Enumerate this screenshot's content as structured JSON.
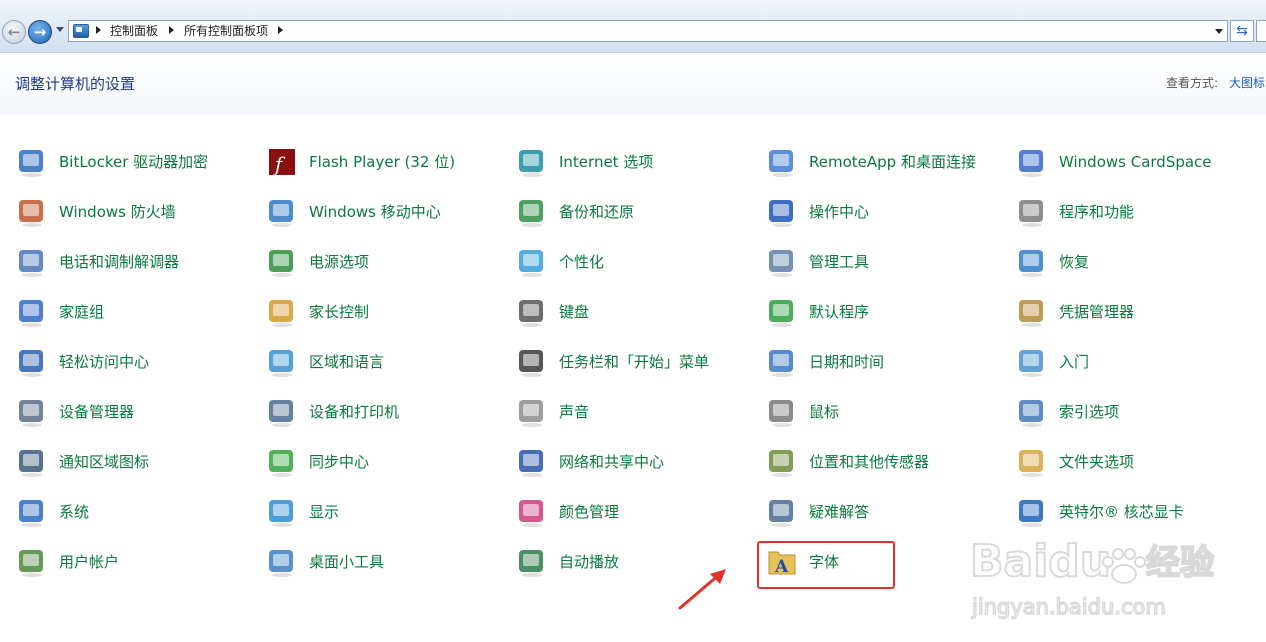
{
  "addressBar": {
    "crumbs": [
      "控制面板",
      "所有控制面板项"
    ]
  },
  "header": {
    "title": "调整计算机的设置",
    "viewLabel": "查看方式:",
    "viewValue": "大图标"
  },
  "items": [
    {
      "label": "BitLocker 驱动器加密",
      "icon": "bitlocker-icon"
    },
    {
      "label": "Flash Player (32 位)",
      "icon": "flash-player-icon"
    },
    {
      "label": "Internet 选项",
      "icon": "internet-options-icon"
    },
    {
      "label": "RemoteApp 和桌面连接",
      "icon": "remoteapp-icon"
    },
    {
      "label": "Windows CardSpace",
      "icon": "cardspace-icon"
    },
    {
      "label": "Windows 防火墙",
      "icon": "firewall-icon"
    },
    {
      "label": "Windows 移动中心",
      "icon": "mobility-center-icon"
    },
    {
      "label": "备份和还原",
      "icon": "backup-restore-icon"
    },
    {
      "label": "操作中心",
      "icon": "action-center-flag-icon"
    },
    {
      "label": "程序和功能",
      "icon": "programs-features-icon"
    },
    {
      "label": "电话和调制解调器",
      "icon": "phone-modem-icon"
    },
    {
      "label": "电源选项",
      "icon": "power-options-icon"
    },
    {
      "label": "个性化",
      "icon": "personalization-icon"
    },
    {
      "label": "管理工具",
      "icon": "admin-tools-icon"
    },
    {
      "label": "恢复",
      "icon": "recovery-icon"
    },
    {
      "label": "家庭组",
      "icon": "homegroup-icon"
    },
    {
      "label": "家长控制",
      "icon": "parental-controls-icon"
    },
    {
      "label": "键盘",
      "icon": "keyboard-icon"
    },
    {
      "label": "默认程序",
      "icon": "default-programs-icon"
    },
    {
      "label": "凭据管理器",
      "icon": "credential-manager-icon"
    },
    {
      "label": "轻松访问中心",
      "icon": "ease-of-access-icon"
    },
    {
      "label": "区域和语言",
      "icon": "region-language-icon"
    },
    {
      "label": "任务栏和「开始」菜单",
      "icon": "taskbar-start-icon"
    },
    {
      "label": "日期和时间",
      "icon": "date-time-icon"
    },
    {
      "label": "入门",
      "icon": "getting-started-icon"
    },
    {
      "label": "设备管理器",
      "icon": "device-manager-icon"
    },
    {
      "label": "设备和打印机",
      "icon": "devices-printers-icon"
    },
    {
      "label": "声音",
      "icon": "sound-icon"
    },
    {
      "label": "鼠标",
      "icon": "mouse-icon"
    },
    {
      "label": "索引选项",
      "icon": "indexing-options-icon"
    },
    {
      "label": "通知区域图标",
      "icon": "notification-area-icon"
    },
    {
      "label": "同步中心",
      "icon": "sync-center-icon"
    },
    {
      "label": "网络和共享中心",
      "icon": "network-sharing-icon"
    },
    {
      "label": "位置和其他传感器",
      "icon": "location-sensors-icon"
    },
    {
      "label": "文件夹选项",
      "icon": "folder-options-icon"
    },
    {
      "label": "系统",
      "icon": "system-icon"
    },
    {
      "label": "显示",
      "icon": "display-icon"
    },
    {
      "label": "颜色管理",
      "icon": "color-management-icon"
    },
    {
      "label": "疑难解答",
      "icon": "troubleshooting-icon"
    },
    {
      "label": "英特尔® 核芯显卡",
      "icon": "intel-graphics-icon"
    },
    {
      "label": "用户帐户",
      "icon": "user-accounts-icon"
    },
    {
      "label": "桌面小工具",
      "icon": "desktop-gadgets-icon"
    },
    {
      "label": "自动播放",
      "icon": "autoplay-icon"
    },
    {
      "label": "字体",
      "icon": "fonts-icon"
    }
  ],
  "watermark": {
    "brand": "Baidu",
    "word": "经验",
    "url": "jingyan.baidu.com"
  }
}
